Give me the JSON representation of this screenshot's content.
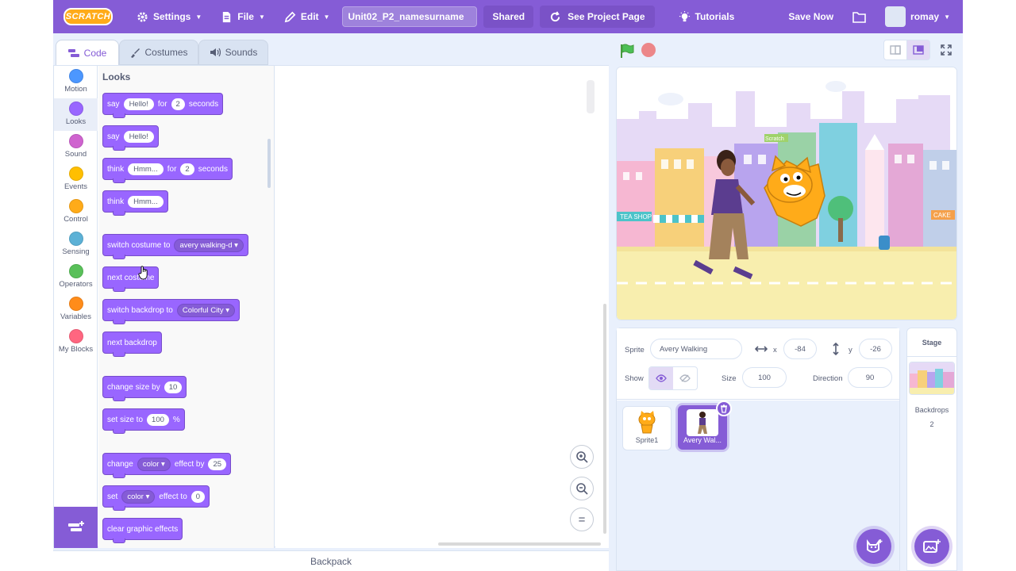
{
  "menubar": {
    "logo": "SCRATCH",
    "settings": "Settings",
    "file": "File",
    "edit": "Edit",
    "project_title": "Unit02_P2_namesurname",
    "shared": "Shared",
    "see_project": "See Project Page",
    "tutorials": "Tutorials",
    "save_now": "Save Now",
    "username": "romay"
  },
  "tabs": {
    "code": "Code",
    "costumes": "Costumes",
    "sounds": "Sounds"
  },
  "categories": [
    {
      "label": "Motion",
      "color": "#4c97ff"
    },
    {
      "label": "Looks",
      "color": "#9966ff"
    },
    {
      "label": "Sound",
      "color": "#cf63cf"
    },
    {
      "label": "Events",
      "color": "#ffbf00"
    },
    {
      "label": "Control",
      "color": "#ffab19"
    },
    {
      "label": "Sensing",
      "color": "#5cb1d6"
    },
    {
      "label": "Operators",
      "color": "#59c059"
    },
    {
      "label": "Variables",
      "color": "#ff8c1a"
    },
    {
      "label": "My Blocks",
      "color": "#ff6680"
    }
  ],
  "palette": {
    "title": "Looks",
    "blocks": {
      "say_for": {
        "say": "say",
        "msg": "Hello!",
        "for": "for",
        "secs": "2",
        "seconds": "seconds"
      },
      "say": {
        "say": "say",
        "msg": "Hello!"
      },
      "think_for": {
        "think": "think",
        "msg": "Hmm...",
        "for": "for",
        "secs": "2",
        "seconds": "seconds"
      },
      "think": {
        "think": "think",
        "msg": "Hmm..."
      },
      "switch_costume": {
        "text": "switch costume to",
        "value": "avery walking-d"
      },
      "next_costume": "next costume",
      "switch_backdrop": {
        "text": "switch backdrop to",
        "value": "Colorful City"
      },
      "next_backdrop": "next backdrop",
      "change_size": {
        "text": "change size by",
        "value": "10"
      },
      "set_size": {
        "text": "set size to",
        "value": "100",
        "unit": "%"
      },
      "change_effect": {
        "change": "change",
        "effect": "color",
        "by": "effect by",
        "value": "25"
      },
      "set_effect": {
        "set": "set",
        "effect": "color",
        "to": "effect to",
        "value": "0"
      },
      "clear_effects": "clear graphic effects"
    }
  },
  "zoom": {
    "in": "+",
    "out": "−",
    "reset": "="
  },
  "backpack": "Backpack",
  "sprite_info": {
    "sprite_label": "Sprite",
    "sprite_name": "Avery Walking",
    "x_label": "x",
    "x_value": "-84",
    "y_label": "y",
    "y_value": "-26",
    "show_label": "Show",
    "size_label": "Size",
    "size_value": "100",
    "direction_label": "Direction",
    "direction_value": "90"
  },
  "sprites": [
    {
      "name": "Sprite1",
      "selected": false
    },
    {
      "name": "Avery Wal...",
      "selected": true
    }
  ],
  "stage_pane": {
    "title": "Stage",
    "backdrops_label": "Backdrops",
    "backdrops_count": "2"
  },
  "stage": {
    "shop_label": "TEA SHOP",
    "cake_label": "CAKE",
    "scratch_sign": "Scratch"
  }
}
